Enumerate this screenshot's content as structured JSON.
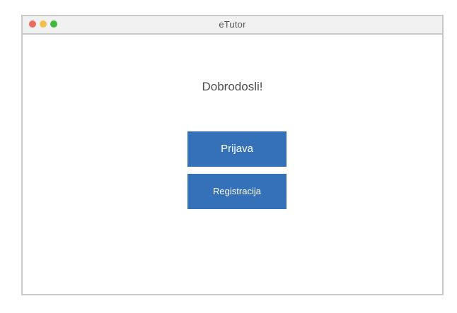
{
  "window": {
    "title": "eTutor",
    "controls": [
      {
        "name": "close",
        "color": "#ed6a5e"
      },
      {
        "name": "minimize",
        "color": "#f4bf4f"
      },
      {
        "name": "zoom",
        "color": "#3dbb3d"
      }
    ]
  },
  "main": {
    "welcome_text": "Dobrodosli!",
    "login_label": "Prijava",
    "register_label": "Registracija"
  },
  "colors": {
    "accent": "#3471b8",
    "button_text": "#ffffff",
    "border": "#c9c9c9",
    "titlebar": "#f1f1f1"
  }
}
